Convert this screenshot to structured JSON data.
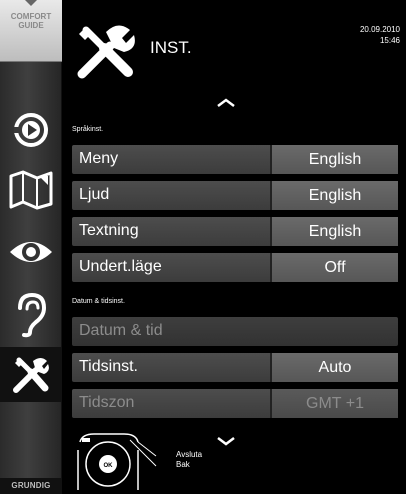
{
  "sidebar": {
    "comfort_guide": [
      "COMFORT",
      "GUIDE"
    ],
    "icons": [
      "playback-icon",
      "map-icon",
      "eye-icon",
      "ear-icon",
      "tools-icon"
    ],
    "brand": "GRUNDIG"
  },
  "header": {
    "title": "INST.",
    "date": "20.09.2010",
    "time": "15:46"
  },
  "sections": [
    {
      "label": "Språkinst.",
      "rows": [
        {
          "label": "Meny",
          "value": "English"
        },
        {
          "label": "Ljud",
          "value": "English"
        },
        {
          "label": "Textning",
          "value": "English"
        },
        {
          "label": "Undert.läge",
          "value": "Off"
        }
      ]
    },
    {
      "label": "Datum & tidsinst.",
      "rows": [
        {
          "label": "Datum & tid",
          "value": ""
        },
        {
          "label": "Tidsinst.",
          "value": "Auto"
        },
        {
          "label": "Tidszon",
          "value": "GMT +1"
        }
      ]
    }
  ],
  "footer": {
    "remote_ok": "OK",
    "hint_exit": "Avsluta",
    "hint_back": "Bak"
  }
}
